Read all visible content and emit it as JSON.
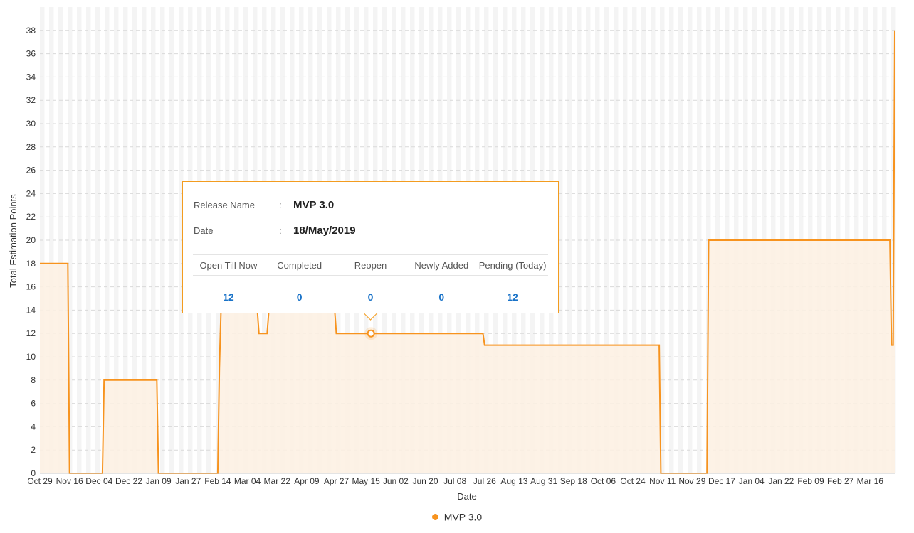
{
  "colors": {
    "series": "#f7931e",
    "fill": "#fdf0e2",
    "grid": "#e6e6e6",
    "tooltip_border": "#f39c1f",
    "tooltip_value": "#1a73c8"
  },
  "chart_data": {
    "type": "area",
    "xlabel": "Date",
    "ylabel": "Total Estimation Points",
    "ylim": [
      0,
      40
    ],
    "yticks": [
      0,
      2,
      4,
      6,
      8,
      10,
      12,
      14,
      16,
      18,
      20,
      22,
      24,
      26,
      28,
      30,
      32,
      34,
      36,
      38
    ],
    "xticks": [
      "Oct 29",
      "Nov 16",
      "Dec 04",
      "Dec 22",
      "Jan 09",
      "Jan 27",
      "Feb 14",
      "Mar 04",
      "Mar 22",
      "Apr 09",
      "Apr 27",
      "May 15",
      "Jun 02",
      "Jun 20",
      "Jul 08",
      "Jul 26",
      "Aug 13",
      "Aug 31",
      "Sep 18",
      "Oct 06",
      "Oct 24",
      "Nov 11",
      "Nov 29",
      "Dec 17",
      "Jan 04",
      "Jan 22",
      "Feb 09",
      "Feb 27",
      "Mar 16"
    ],
    "grid": "on",
    "legend_position": "bottom-center",
    "series": [
      {
        "name": "MVP 3.0",
        "color": "#f7931e",
        "points": [
          [
            "2018-10-29",
            18
          ],
          [
            "2018-11-15",
            18
          ],
          [
            "2018-11-16",
            0
          ],
          [
            "2018-12-06",
            0
          ],
          [
            "2018-12-07",
            8
          ],
          [
            "2019-01-08",
            8
          ],
          [
            "2019-01-09",
            0
          ],
          [
            "2019-02-14",
            0
          ],
          [
            "2019-02-15",
            9
          ],
          [
            "2019-02-16",
            14
          ],
          [
            "2019-03-10",
            14
          ],
          [
            "2019-03-11",
            12
          ],
          [
            "2019-03-16",
            12
          ],
          [
            "2019-03-17",
            14
          ],
          [
            "2019-04-26",
            14
          ],
          [
            "2019-04-27",
            12
          ],
          [
            "2019-07-25",
            12
          ],
          [
            "2019-07-26",
            11
          ],
          [
            "2019-11-09",
            11
          ],
          [
            "2019-11-10",
            0
          ],
          [
            "2019-12-08",
            0
          ],
          [
            "2019-12-09",
            20
          ],
          [
            "2020-03-28",
            20
          ],
          [
            "2020-03-29",
            11
          ],
          [
            "2020-03-30",
            11
          ],
          [
            "2020-03-31",
            38
          ]
        ]
      }
    ],
    "highlight": {
      "date": "2019-05-18",
      "value": 12
    }
  },
  "tooltip": {
    "release_label": "Release Name",
    "release_value": "MVP 3.0",
    "date_label": "Date",
    "date_value": "18/May/2019",
    "colon": ":",
    "columns": [
      "Open Till Now",
      "Completed",
      "Reopen",
      "Newly Added",
      "Pending (Today)"
    ],
    "values": [
      "12",
      "0",
      "0",
      "0",
      "12"
    ]
  },
  "legend": {
    "items": [
      {
        "name": "MVP 3.0",
        "color": "#f7931e"
      }
    ]
  }
}
